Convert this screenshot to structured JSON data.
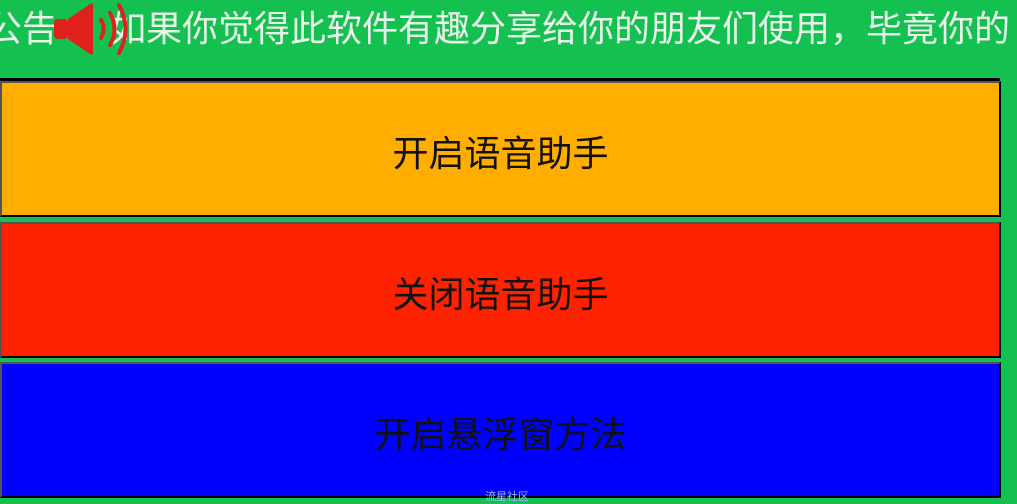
{
  "announcement": {
    "prefix": "公告",
    "text": "如果你觉得此软件有趣分享给你的朋友们使用，毕竟你的"
  },
  "buttons": {
    "enable_voice_assistant": "开启语音助手",
    "disable_voice_assistant": "关闭语音助手",
    "enable_floating_window_method": "开启悬浮窗方法"
  },
  "watermark": {
    "text": "流星社区"
  },
  "colors": {
    "background": "#14c050",
    "enable_button": "#ffae00",
    "disable_button": "#ff2200",
    "float_button": "#0000ff",
    "speaker": "#e0201b"
  },
  "icons": {
    "announcement_icon": "speaker-icon"
  }
}
